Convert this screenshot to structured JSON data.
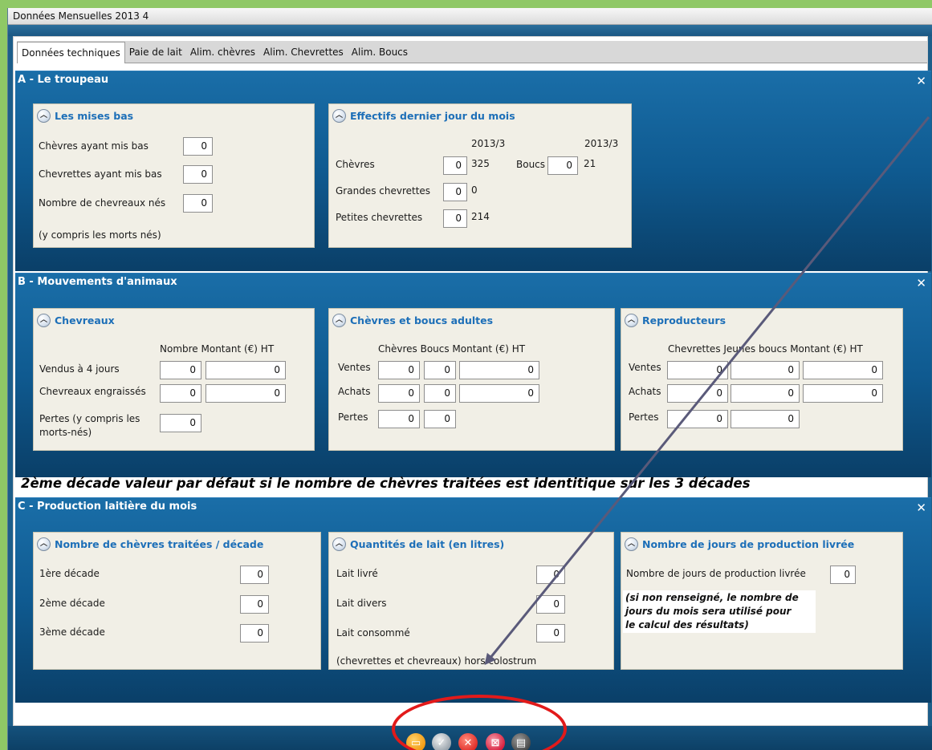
{
  "window": {
    "title": "Données Mensuelles 2013 4"
  },
  "tabs": [
    "Données techniques",
    "Paie de lait",
    "Alim. chèvres",
    "Alim. Chevrettes",
    "Alim. Boucs"
  ],
  "section_a": {
    "title": "A - Le troupeau",
    "mises_bas": {
      "title": "Les mises bas",
      "rows": [
        {
          "label": "Chèvres ayant mis bas",
          "value": "0"
        },
        {
          "label": "Chevrettes ayant mis bas",
          "value": "0"
        },
        {
          "label": "Nombre de chevreaux nés",
          "value": "0"
        }
      ],
      "note": "(y compris les morts nés)"
    },
    "effectifs": {
      "title": "Effectifs dernier jour du mois",
      "col_left": "2013/3",
      "col_right": "2013/3",
      "chevres": {
        "label": "Chèvres",
        "value": "0",
        "prev": "325"
      },
      "boucs": {
        "label": "Boucs",
        "value": "0",
        "prev": "21"
      },
      "grandes": {
        "label": "Grandes chevrettes",
        "value": "0",
        "prev": "0"
      },
      "petites": {
        "label": "Petites chevrettes",
        "value": "0",
        "prev": "214"
      }
    }
  },
  "section_b": {
    "title": "B - Mouvements d'animaux",
    "chevreaux": {
      "title": "Chevreaux",
      "headers": "Nombre Montant (€) HT",
      "vendus": {
        "label": "Vendus à 4 jours",
        "nombre": "0",
        "montant": "0"
      },
      "engraisses": {
        "label": "Chevreaux engraissés",
        "nombre": "0",
        "montant": "0"
      },
      "pertes": {
        "label_1": "Pertes (y compris les",
        "label_2": "morts-nés)",
        "nombre": "0"
      }
    },
    "adultes": {
      "title": "Chèvres et boucs adultes",
      "headers": "Chèvres Boucs Montant (€) HT",
      "ventes": {
        "label": "Ventes",
        "chevres": "0",
        "boucs": "0",
        "montant": "0"
      },
      "achats": {
        "label": "Achats",
        "chevres": "0",
        "boucs": "0",
        "montant": "0"
      },
      "pertes": {
        "label": "Pertes",
        "chevres": "0",
        "boucs": "0"
      }
    },
    "reproducteurs": {
      "title": "Reproducteurs",
      "headers": "Chevrettes Jeunes boucs Montant (€) HT",
      "ventes": {
        "label": "Ventes",
        "chevrettes": "0",
        "jeunes": "0",
        "montant": "0"
      },
      "achats": {
        "label": "Achats",
        "chevrettes": "0",
        "jeunes": "0",
        "montant": "0"
      },
      "pertes": {
        "label": "Pertes",
        "chevrettes": "0",
        "jeunes": "0"
      }
    }
  },
  "banner": "2ème décade valeur par défaut si le nombre de chèvres traitées est identitique sur les 3 décades",
  "section_c": {
    "title": "C - Production laitière du mois",
    "traitees": {
      "title": "Nombre de chèvres traitées / décade",
      "rows": [
        {
          "label": "1ère décade",
          "value": "0"
        },
        {
          "label": "2ème décade",
          "value": "0"
        },
        {
          "label": "3ème décade",
          "value": "0"
        }
      ]
    },
    "quantites": {
      "title": "Quantités de lait (en litres)",
      "rows": [
        {
          "label": "Lait livré",
          "value": "0"
        },
        {
          "label": "Lait divers",
          "value": "0"
        },
        {
          "label": "Lait consommé",
          "value": "0"
        }
      ],
      "note": "(chevrettes et chevreaux) hors colostrum"
    },
    "jours": {
      "title": "Nombre de jours de production livrée",
      "label": "Nombre de jours de production livrée",
      "value": "0",
      "note_1": "(si non renseigné, le nombre de",
      "note_2": "jours du mois sera utilisé pour",
      "note_3": "le calcul des résultats)"
    }
  },
  "close_glyph": "✕",
  "buttons": [
    "list-icon",
    "validate-icon",
    "cancel-icon",
    "delete-icon",
    "print-icon"
  ],
  "annotation_colors": {
    "arrow": "#5a5a7a",
    "oval": "#e21a1a"
  }
}
